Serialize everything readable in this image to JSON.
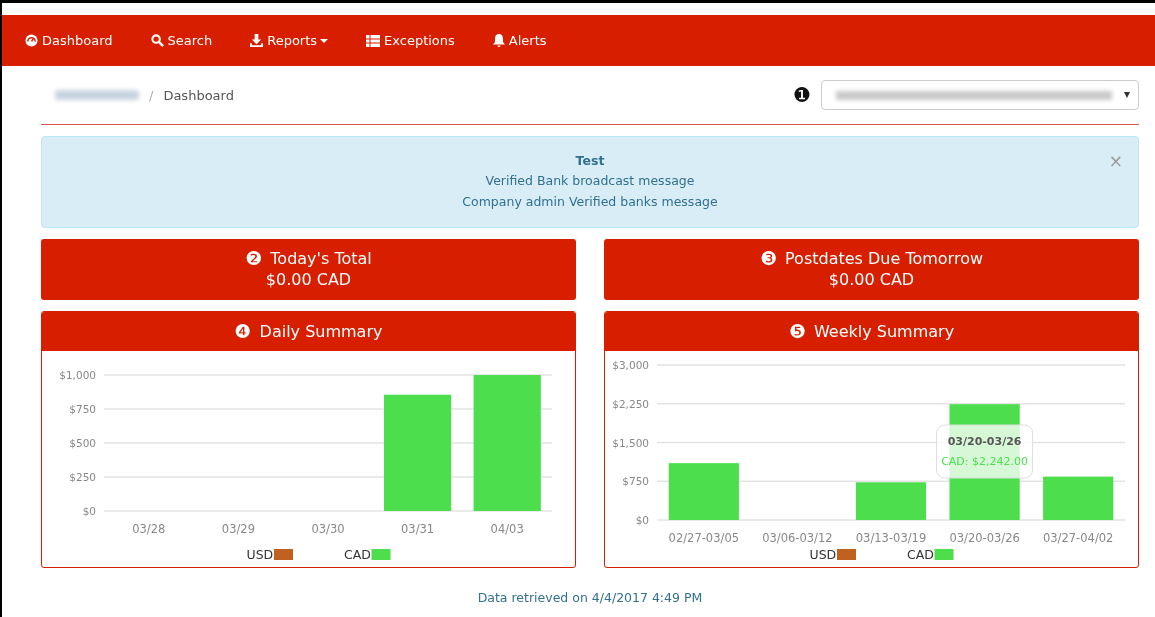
{
  "navbar": {
    "items": [
      {
        "label": "Dashboard",
        "dropdown": false
      },
      {
        "label": "Search",
        "dropdown": false
      },
      {
        "label": "Reports",
        "dropdown": true
      },
      {
        "label": "Exceptions",
        "dropdown": false
      },
      {
        "label": "Alerts",
        "dropdown": false
      }
    ]
  },
  "breadcrumb": {
    "separator": "/",
    "current": "Dashboard"
  },
  "company_select": {
    "badge": "❶"
  },
  "alert": {
    "title": "Test",
    "messages": [
      "Verified Bank broadcast message",
      "Company admin Verified banks message"
    ],
    "close": "×"
  },
  "summary_cards": [
    {
      "badge": "❷",
      "title": "Today's Total",
      "amount": "$0.00 CAD"
    },
    {
      "badge": "❸",
      "title": "Postdates Due Tomorrow",
      "amount": "$0.00 CAD"
    }
  ],
  "chart_panels": [
    {
      "badge": "❹",
      "title": "Daily Summary",
      "chart_data": {
        "type": "bar",
        "categories": [
          "03/28",
          "03/29",
          "03/30",
          "03/31",
          "04/03"
        ],
        "series": [
          {
            "name": "USD",
            "color": "#c0611f",
            "values": [
              0,
              0,
              0,
              0,
              0
            ]
          },
          {
            "name": "CAD",
            "color": "#4cde4c",
            "values": [
              0,
              0,
              0,
              855,
              1000
            ]
          }
        ],
        "grid": true,
        "ylim": [
          0,
          1000
        ],
        "yticks": [
          {
            "value": 0,
            "label": "$0"
          },
          {
            "value": 250,
            "label": "$250"
          },
          {
            "value": 500,
            "label": "$500"
          },
          {
            "value": 750,
            "label": "$750"
          },
          {
            "value": 1000,
            "label": "$1,000"
          }
        ]
      }
    },
    {
      "badge": "❺",
      "title": "Weekly Summary",
      "chart_data": {
        "type": "bar",
        "categories": [
          "02/27-03/05",
          "03/06-03/12",
          "03/13-03/19",
          "03/20-03/26",
          "03/27-04/02"
        ],
        "series": [
          {
            "name": "USD",
            "color": "#c0611f",
            "values": [
              0,
              0,
              0,
              0,
              0
            ]
          },
          {
            "name": "CAD",
            "color": "#4cde4c",
            "values": [
              1100,
              0,
              730,
              2242,
              840
            ]
          }
        ],
        "grid": true,
        "ylim": [
          0,
          3000
        ],
        "yticks": [
          {
            "value": 0,
            "label": "$0"
          },
          {
            "value": 750,
            "label": "$750"
          },
          {
            "value": 1500,
            "label": "$1,500"
          },
          {
            "value": 2250,
            "label": "$2,250"
          },
          {
            "value": 3000,
            "label": "$3,000"
          }
        ]
      },
      "tooltip": {
        "title": "03/20-03/26",
        "text": "CAD: $2,242.00"
      }
    }
  ],
  "footer": {
    "text": "Data retrieved on 4/4/2017 4:49 PM"
  }
}
